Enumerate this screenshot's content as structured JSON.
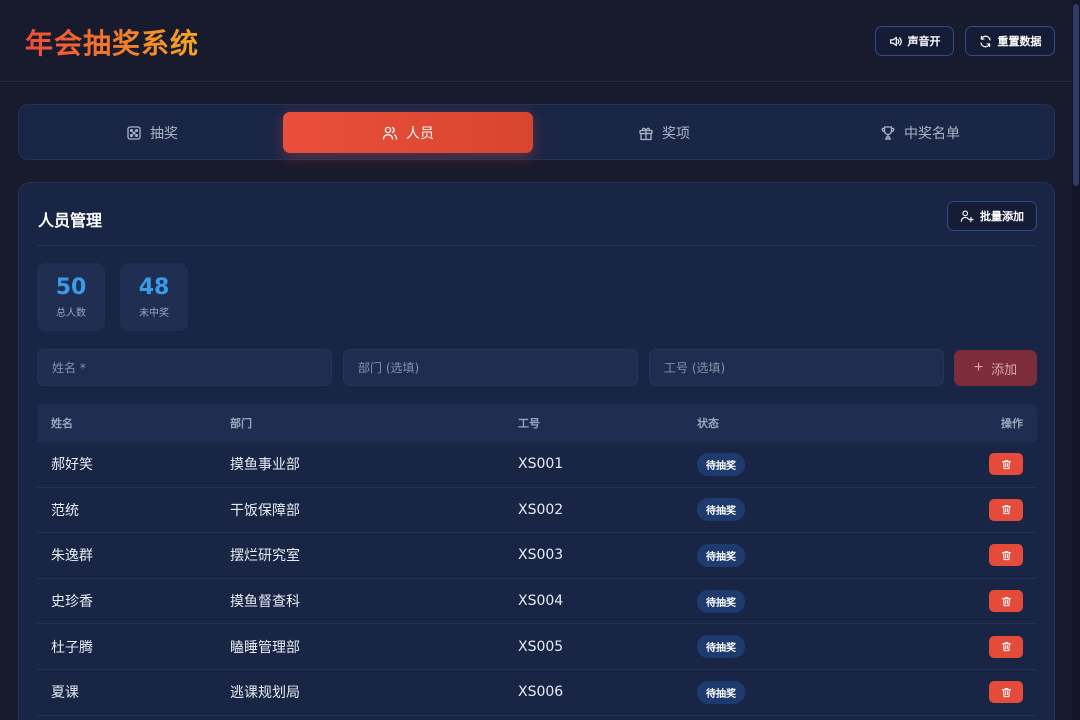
{
  "header": {
    "title": "年会抽奖系统",
    "sound_label": "声音开",
    "reset_label": "重置数据"
  },
  "tabs": [
    {
      "label": "抽奖",
      "icon": "dice-icon",
      "active": false
    },
    {
      "label": "人员",
      "icon": "users-icon",
      "active": true
    },
    {
      "label": "奖项",
      "icon": "gift-icon",
      "active": false
    },
    {
      "label": "中奖名单",
      "icon": "trophy-icon",
      "active": false
    }
  ],
  "panel": {
    "title": "人员管理",
    "batch_add_label": "批量添加"
  },
  "stats": [
    {
      "value": "50",
      "label": "总人数"
    },
    {
      "value": "48",
      "label": "未中奖"
    }
  ],
  "form": {
    "name_placeholder": "姓名 *",
    "dept_placeholder": "部门 (选填)",
    "id_placeholder": "工号 (选填)",
    "add_label": "添加"
  },
  "table": {
    "headers": {
      "name": "姓名",
      "dept": "部门",
      "id": "工号",
      "status": "状态",
      "op": "操作"
    },
    "rows": [
      {
        "name": "郝好笑",
        "dept": "摸鱼事业部",
        "id": "XS001",
        "status": "待抽奖"
      },
      {
        "name": "范统",
        "dept": "干饭保障部",
        "id": "XS002",
        "status": "待抽奖"
      },
      {
        "name": "朱逸群",
        "dept": "摆烂研究室",
        "id": "XS003",
        "status": "待抽奖"
      },
      {
        "name": "史珍香",
        "dept": "摸鱼督查科",
        "id": "XS004",
        "status": "待抽奖"
      },
      {
        "name": "杜子腾",
        "dept": "瞌睡管理部",
        "id": "XS005",
        "status": "待抽奖"
      },
      {
        "name": "夏课",
        "dept": "逃课规划局",
        "id": "XS006",
        "status": "待抽奖"
      }
    ]
  },
  "colors": {
    "accent": "#ea4f3c",
    "stat_number": "#3a9ce8",
    "badge_bg": "#1d3b6e",
    "background": "#181a2e"
  }
}
